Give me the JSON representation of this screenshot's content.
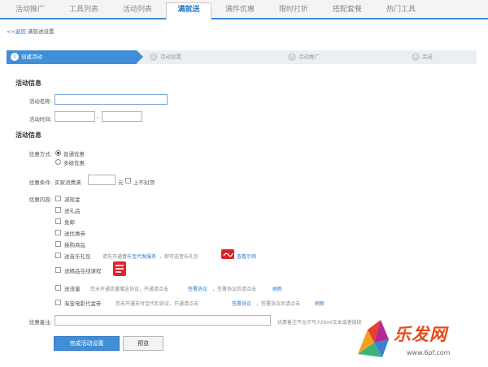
{
  "tabs": [
    {
      "label": "活动推广"
    },
    {
      "label": "工具列表"
    },
    {
      "label": "活动列表"
    },
    {
      "label": "满就送"
    },
    {
      "label": "满件优惠"
    },
    {
      "label": "限时打折"
    },
    {
      "label": "搭配套餐"
    },
    {
      "label": "热门工具"
    }
  ],
  "breadcrumb": {
    "back": "<<返回",
    "current": "满就送设置"
  },
  "steps": [
    {
      "num": "1",
      "label": "创建活动"
    },
    {
      "num": "2",
      "label": "活动设置"
    },
    {
      "num": "3",
      "label": "活动推广"
    },
    {
      "num": "4",
      "label": "完成"
    }
  ],
  "activity_info": {
    "title": "活动信息",
    "name_label": "活动名称:",
    "time_label": "活动时间:",
    "time_sep": "-"
  },
  "discount_info": {
    "title": "活动信息",
    "method_label": "优惠方式:",
    "method_options": [
      "普通优惠",
      "多级优惠"
    ],
    "condition_label": "优惠条件:",
    "condition_prefix": "买家消费满",
    "condition_unit": "元",
    "no_cap_label": "上不封顶",
    "content_label": "优惠内容:",
    "content_items": [
      "减现金",
      "送礼品",
      "免邮",
      "送优惠券",
      "换购商品",
      "送音乐礼包",
      "送精品在线课程",
      "送流量",
      "淘宝电影代金券"
    ]
  },
  "music_note": {
    "text": "请先开通",
    "link": "音乐宝代发服务",
    "tail": "，即可送音乐礼包",
    "sample": "查看示例"
  },
  "traffic_note": {
    "text": "您未开通流量赠送协议，开通请点击",
    "link": "签署协议",
    "tail": "，签署协议后请点击",
    "refresh": "刷新"
  },
  "movie_note": {
    "text": "您未开通支付宝代扣协议，开通请点击",
    "link": "签署协议",
    "tail": "，签署协议后请点击",
    "refresh": "刷新"
  },
  "remark": {
    "label": "优惠备注:",
    "hint": "优惠备注不允许写入html文本或者链接"
  },
  "buttons": {
    "primary": "完成活动设置",
    "secondary": "预览"
  },
  "watermark": {
    "text": "乐发网",
    "url": "www.6pf.com"
  },
  "colors": {
    "accent": "#3f8fd8",
    "link": "#2f7bd1",
    "watermark": "#e84b1b"
  }
}
